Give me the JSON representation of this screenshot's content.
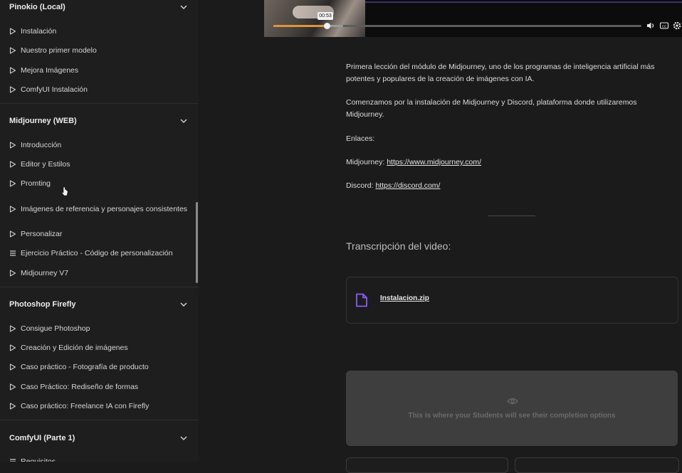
{
  "sidebar": {
    "sections": [
      {
        "title": "Pinokio (Local)",
        "lessons": [
          {
            "label": "Instalación",
            "icon": "play-icon"
          },
          {
            "label": "Nuestro primer modelo",
            "icon": "play-icon"
          },
          {
            "label": "Mejora Imágenes",
            "icon": "play-icon"
          },
          {
            "label": "ComfyUI Instalación",
            "icon": "play-icon"
          }
        ]
      },
      {
        "title": "Midjourney (WEB)",
        "lessons": [
          {
            "label": "Introducción",
            "icon": "play-icon"
          },
          {
            "label": "Editor y Estilos",
            "icon": "play-icon"
          },
          {
            "label": "Promting",
            "icon": "play-icon"
          },
          {
            "label": "Imágenes de referencia y personajes consistentes",
            "icon": "play-icon"
          },
          {
            "label": "Personalizar",
            "icon": "play-icon"
          },
          {
            "label": "Ejercicio Práctico - Código de personalización",
            "icon": "text-lines-icon"
          },
          {
            "label": "Midjourney V7",
            "icon": "play-icon"
          }
        ]
      },
      {
        "title": "Photoshop Firefly",
        "lessons": [
          {
            "label": "Consigue Photoshop",
            "icon": "play-icon"
          },
          {
            "label": "Creación y Edición de imágenes",
            "icon": "play-icon"
          },
          {
            "label": "Caso práctico - Fotografía de producto",
            "icon": "play-icon"
          },
          {
            "label": "Caso Práctico: Rediseño de formas",
            "icon": "play-icon"
          },
          {
            "label": "Caso práctico: Freelance IA con Firefly",
            "icon": "play-icon"
          }
        ]
      },
      {
        "title": "ComfyUI (Parte 1)",
        "lessons": [
          {
            "label": "Requisitos",
            "icon": "text-lines-icon"
          }
        ]
      }
    ]
  },
  "video": {
    "current_time": "00:53",
    "progress_fraction": 0.146,
    "controls": [
      "volume-icon",
      "captions-icon",
      "settings-icon"
    ]
  },
  "lesson": {
    "description": "Primera lección del módulo de Midjourney, uno de los programas de inteligencia artificial más potentes y populares de la creación de imágenes con IA.",
    "intro": "Comenzamos por la instalación de Midjourney y Discord, plataforma donde utilizaremos Midjourney.",
    "links_label": "Enlaces:",
    "links": [
      {
        "name": "Midjourney:",
        "url": "https://www.midjourney.com/"
      },
      {
        "name": "Discord:",
        "url": "https://discord.com/"
      }
    ],
    "transcript_title": "Transcripción del video:",
    "attachment": {
      "filename": "Instalacion.zip",
      "icon": "file-icon"
    },
    "completion_text": "This is where your Students will see their completion options"
  },
  "colors": {
    "accent_progress": "#e1933a",
    "file_icon": "#8b5cf6",
    "background": "#1b1b1b"
  }
}
